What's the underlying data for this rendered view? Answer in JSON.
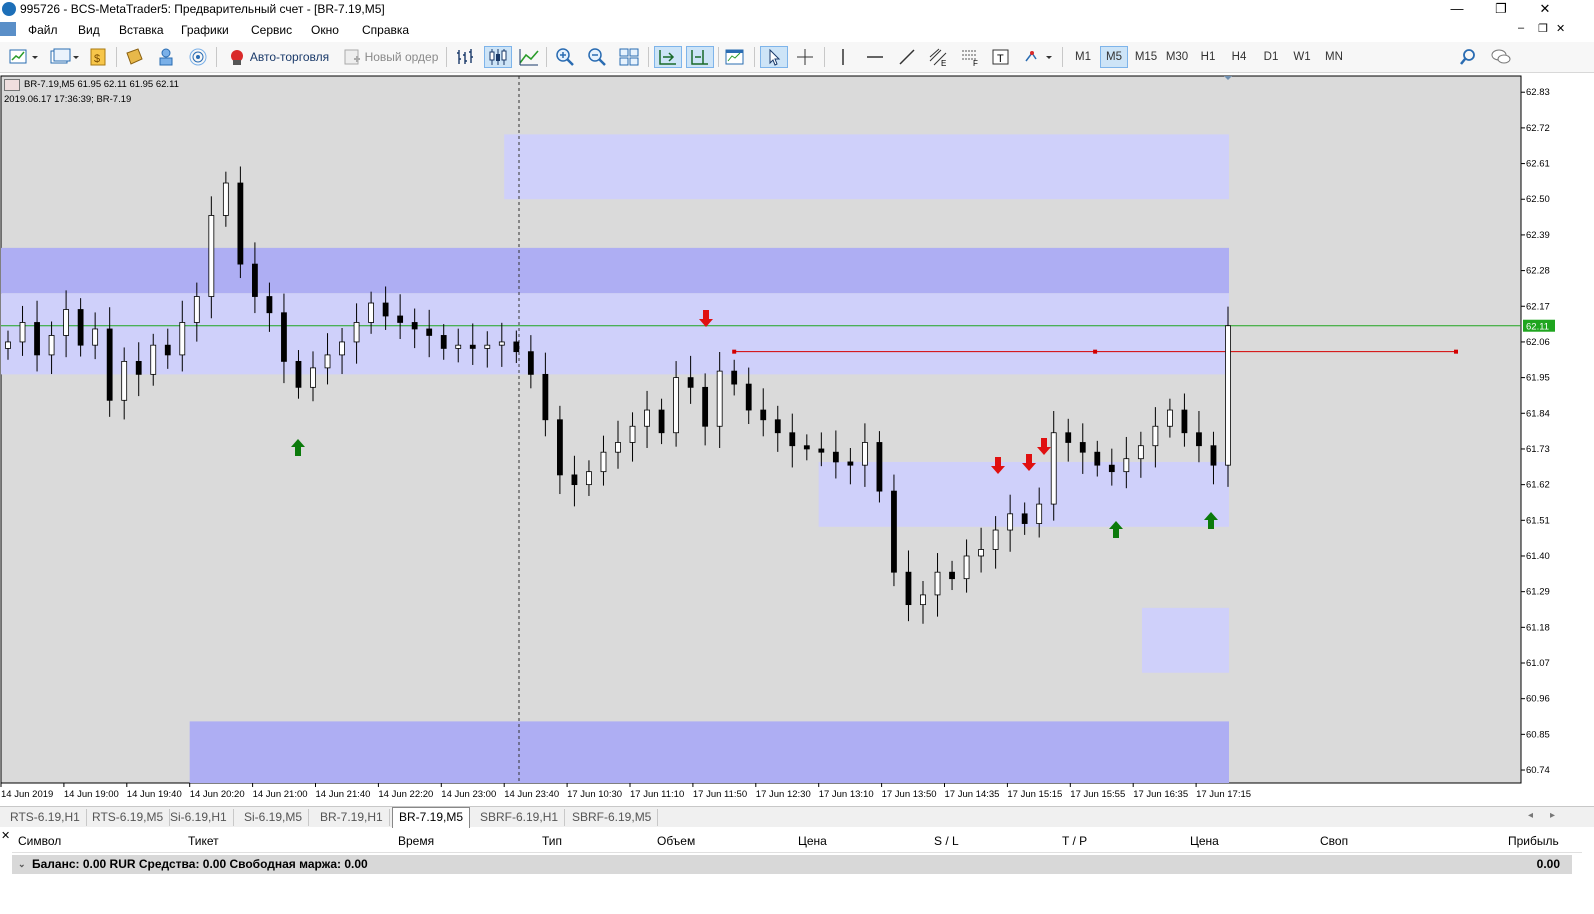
{
  "window": {
    "title": "995726 - BCS-MetaTrader5: Предварительный счет - [BR-7.19,M5]",
    "minimize": "—",
    "maximize": "❐",
    "close": "✕"
  },
  "menu": [
    "Файл",
    "Вид",
    "Вставка",
    "Графики",
    "Сервис",
    "Окно",
    "Справка"
  ],
  "toolbar": {
    "autotrading_label": "Авто-торговля",
    "new_order_label": "Новый ордер",
    "timeframes": [
      "M1",
      "M5",
      "M15",
      "M30",
      "H1",
      "H4",
      "D1",
      "W1",
      "MN"
    ],
    "active_timeframe": "M5"
  },
  "chart": {
    "info_line1": "BR-7.19,M5  61.95 62.11 61.95 62.11",
    "info_line2": "2019.06.17 17:36:39; BR-7.19",
    "current_price_label": "62.11",
    "price_axis": [
      "62.83",
      "62.72",
      "62.61",
      "62.50",
      "62.39",
      "62.28",
      "62.17",
      "62.06",
      "61.95",
      "61.84",
      "61.73",
      "61.62",
      "61.51",
      "61.40",
      "61.29",
      "61.18",
      "61.07",
      "60.96",
      "60.85",
      "60.74"
    ],
    "time_axis": [
      "14 Jun 2019",
      "14 Jun 19:00",
      "14 Jun 19:40",
      "14 Jun 20:20",
      "14 Jun 21:00",
      "14 Jun 21:40",
      "14 Jun 22:20",
      "14 Jun 23:00",
      "14 Jun 23:40",
      "17 Jun 10:30",
      "17 Jun 11:10",
      "17 Jun 11:50",
      "17 Jun 12:30",
      "17 Jun 13:10",
      "17 Jun 13:50",
      "17 Jun 14:35",
      "17 Jun 15:15",
      "17 Jun 15:55",
      "17 Jun 16:35",
      "17 Jun 17:15"
    ],
    "colors": {
      "background": "#dadada",
      "zone_light": "#cfd0fa",
      "zone_dark": "#aeaef3",
      "bid_line": "#1fa51f",
      "level_line": "#d40000",
      "arrow_up": "#0b7a0b",
      "arrow_down": "#e01010"
    }
  },
  "chart_data": {
    "type": "candlestick",
    "symbol": "BR-7.19",
    "timeframe": "M5",
    "ylim": [
      60.7,
      62.88
    ],
    "last_price": 62.11,
    "horizontal_level": 62.03,
    "zones": [
      {
        "from": 62.5,
        "to": 62.7,
        "style": "light",
        "start": "14 Jun 23:40"
      },
      {
        "from": 62.21,
        "to": 62.35,
        "style": "dark",
        "start": "14 Jun 2019"
      },
      {
        "from": 61.96,
        "to": 62.21,
        "style": "light",
        "start": "14 Jun 2019"
      },
      {
        "from": 61.49,
        "to": 61.69,
        "style": "light",
        "start": "17 Jun 13:10"
      },
      {
        "from": 61.04,
        "to": 61.24,
        "style": "light",
        "start": "17 Jun 16:10"
      },
      {
        "from": 60.7,
        "to": 60.89,
        "style": "dark",
        "start": "14 Jun 20:20"
      }
    ],
    "close_path": [
      62.06,
      62.12,
      62.02,
      62.08,
      62.16,
      62.05,
      62.1,
      61.88,
      62.0,
      61.96,
      62.05,
      62.02,
      62.12,
      62.2,
      62.45,
      62.55,
      62.3,
      62.2,
      62.15,
      62.0,
      61.92,
      61.98,
      62.02,
      62.06,
      62.12,
      62.18,
      62.14,
      62.12,
      62.1,
      62.08,
      62.04,
      62.05,
      62.04,
      62.05,
      62.06,
      62.03,
      61.96,
      61.82,
      61.65,
      61.62,
      61.66,
      61.72,
      61.75,
      61.8,
      61.85,
      61.78,
      61.95,
      61.92,
      61.8,
      61.97,
      61.93,
      61.85,
      61.82,
      61.78,
      61.74,
      61.73,
      61.72,
      61.69,
      61.68,
      61.75,
      61.6,
      61.35,
      61.25,
      61.28,
      61.35,
      61.33,
      61.4,
      61.42,
      61.48,
      61.53,
      61.5,
      61.56,
      61.78,
      61.75,
      61.72,
      61.68,
      61.66,
      61.7,
      61.74,
      61.8,
      61.85,
      61.78,
      61.74,
      61.68,
      62.11
    ],
    "signals": [
      {
        "type": "buy",
        "time": "14 Jun 21:00"
      },
      {
        "type": "sell",
        "time": "17 Jun 11:50"
      },
      {
        "type": "sell",
        "time": "17 Jun 14:35"
      },
      {
        "type": "sell",
        "time": "17 Jun 14:50"
      },
      {
        "type": "sell",
        "time": "17 Jun 15:05"
      },
      {
        "type": "buy",
        "time": "17 Jun 15:55"
      },
      {
        "type": "buy",
        "time": "17 Jun 17:05"
      }
    ]
  },
  "tabs": [
    "RTS-6.19,H1",
    "RTS-6.19,M5",
    "Si-6.19,H1",
    "Si-6.19,M5",
    "BR-7.19,H1",
    "BR-7.19,M5",
    "SBRF-6.19,H1",
    "SBRF-6.19,M5"
  ],
  "active_tab": "BR-7.19,M5",
  "terminal": {
    "columns": [
      "Символ",
      "Тикет",
      "Время",
      "Тип",
      "Объем",
      "Цена",
      "S / L",
      "T / P",
      "Цена",
      "Своп",
      "Прибыль"
    ],
    "balance_text": "Баланс: 0.00 RUR  Средства: 0.00  Свободная маржа: 0.00",
    "profit_total": "0.00"
  }
}
